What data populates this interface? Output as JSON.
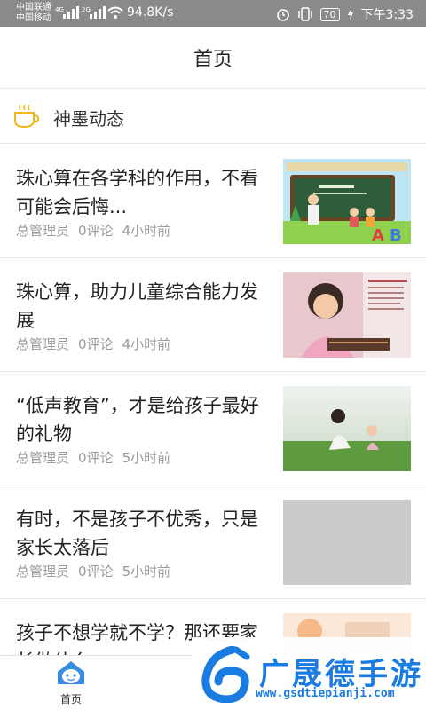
{
  "status_bar": {
    "carrier_1": "中国联通",
    "carrier_2": "中国移动",
    "net_type_1": "4G",
    "net_type_2": "2G",
    "net_speed": "94.8K/s",
    "battery_level": "70",
    "time": "下午3:33"
  },
  "header": {
    "title": "首页"
  },
  "section": {
    "title": "神墨动态",
    "icon": "coffee-cup-icon"
  },
  "articles": [
    {
      "title": "珠心算在各学科的作用，不看可能会后悔...",
      "author": "总管理员",
      "comments": "0评论",
      "time": "4小时前",
      "thumb": "chalkboard-classroom-image"
    },
    {
      "title": "珠心算，助力儿童综合能力发展",
      "author": "总管理员",
      "comments": "0评论",
      "time": "4小时前",
      "thumb": "girl-abacus-image"
    },
    {
      "title": "“低声教育”，才是给孩子最好的礼物",
      "author": "总管理员",
      "comments": "0评论",
      "time": "5小时前",
      "thumb": "mother-child-grass-image"
    },
    {
      "title": "有时，不是孩子不优秀，只是家长太落后",
      "author": "总管理员",
      "comments": "0评论",
      "time": "5小时前",
      "thumb": "placeholder-image"
    },
    {
      "title": "孩子不想学就不学？那还要家长做什么",
      "thumb": "illustration-image"
    }
  ],
  "bottom_nav": {
    "home_label": "首页",
    "home_icon": "home-face-icon"
  },
  "watermark": {
    "title": "广晟德手游",
    "url": "www.gsdtiepianji.com"
  },
  "colors": {
    "status_bar": "#8a8a8a",
    "meta_text": "#999999",
    "watermark": "#1a7be0",
    "section_icon": "#f2b81e"
  }
}
